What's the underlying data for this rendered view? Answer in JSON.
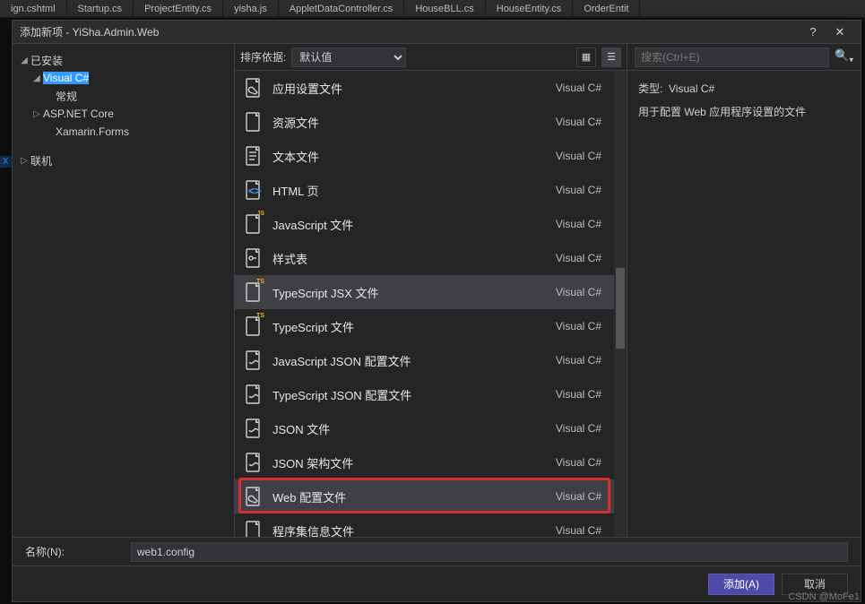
{
  "editorTabs": [
    "ign.cshtml",
    "Startup.cs",
    "ProjectEntity.cs",
    "yisha.js",
    "AppletDataController.cs",
    "HouseBLL.cs",
    "HouseEntity.cs",
    "OrderEntit"
  ],
  "dialog": {
    "title": "添加新项 - YiSha.Admin.Web",
    "help": "?",
    "close": "✕"
  },
  "left": {
    "installed": "已安装",
    "vcsharp": "Visual C#",
    "general": "常规",
    "aspnet": "ASP.NET Core",
    "xamarin": "Xamarin.Forms",
    "online": "联机"
  },
  "xsBadge": "X",
  "sort": {
    "label": "排序依据:",
    "value": "默认值"
  },
  "templates": [
    {
      "name": "应用设置文件",
      "lang": "Visual C#",
      "icon": "wrench"
    },
    {
      "name": "资源文件",
      "lang": "Visual C#",
      "icon": "doc"
    },
    {
      "name": "文本文件",
      "lang": "Visual C#",
      "icon": "lines"
    },
    {
      "name": "HTML 页",
      "lang": "Visual C#",
      "icon": "html"
    },
    {
      "name": "JavaScript 文件",
      "lang": "Visual C#",
      "icon": "js"
    },
    {
      "name": "样式表",
      "lang": "Visual C#",
      "icon": "css"
    },
    {
      "name": "TypeScript JSX 文件",
      "lang": "Visual C#",
      "icon": "ts",
      "sel": true
    },
    {
      "name": "TypeScript 文件",
      "lang": "Visual C#",
      "icon": "ts"
    },
    {
      "name": "JavaScript JSON 配置文件",
      "lang": "Visual C#",
      "icon": "json"
    },
    {
      "name": "TypeScript JSON 配置文件",
      "lang": "Visual C#",
      "icon": "json"
    },
    {
      "name": "JSON 文件",
      "lang": "Visual C#",
      "icon": "json"
    },
    {
      "name": "JSON 架构文件",
      "lang": "Visual C#",
      "icon": "json"
    },
    {
      "name": "Web 配置文件",
      "lang": "Visual C#",
      "icon": "wrench",
      "hl": true
    },
    {
      "name": "程序集信息文件",
      "lang": "Visual C#",
      "icon": "doc"
    }
  ],
  "search": {
    "placeholder": "搜索(Ctrl+E)"
  },
  "details": {
    "typeLabel": "类型:",
    "typeValue": "Visual C#",
    "desc": "用于配置 Web 应用程序设置的文件"
  },
  "name": {
    "label": "名称(N):",
    "value": "web1.config"
  },
  "buttons": {
    "add": "添加(A)",
    "cancel": "取消"
  },
  "watermark": "CSDN @MoFe1"
}
